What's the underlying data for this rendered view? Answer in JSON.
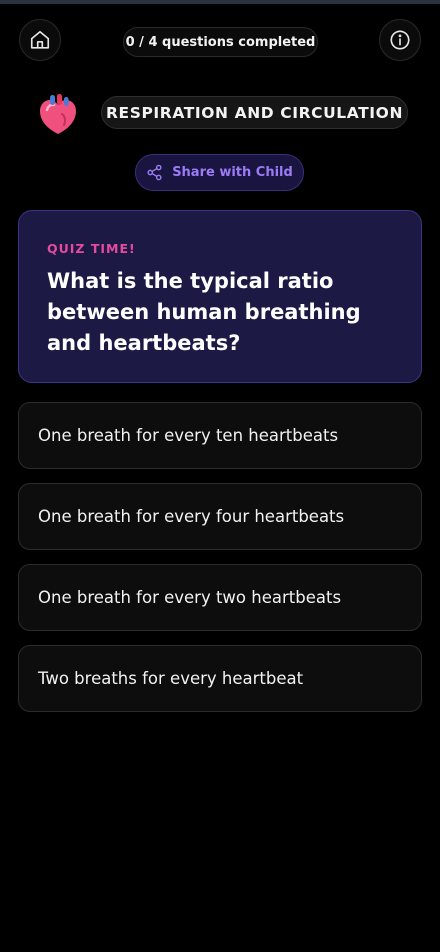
{
  "header": {
    "progress_text": "0 / 4 questions completed"
  },
  "topic": {
    "title": "RESPIRATION AND CIRCULATION",
    "icon": "anatomical-heart-icon"
  },
  "share": {
    "label": "Share with Child"
  },
  "quiz": {
    "tag": "QUIZ TIME!",
    "question": "What is the typical ratio between human breathing and heartbeats?",
    "options": [
      "One breath for every ten heartbeats",
      "One breath for every four heartbeats",
      "One breath for every two heartbeats",
      "Two breaths for every heartbeat"
    ]
  },
  "colors": {
    "background": "#000000",
    "accent_purple": "#9b7cf4",
    "quiz_tag_pink": "#e64aa0",
    "quiz_card_bg": "#1c1a45"
  }
}
